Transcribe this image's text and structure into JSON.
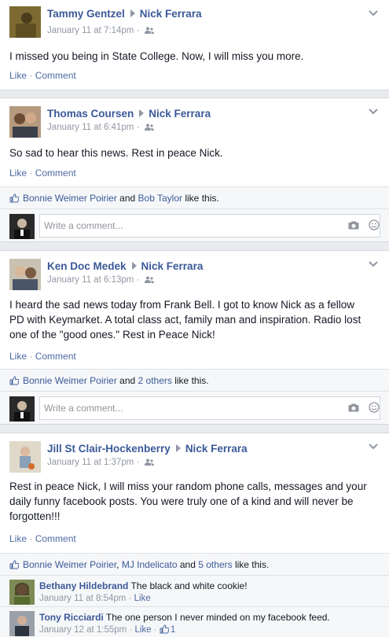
{
  "posts": [
    {
      "author": "Tammy Gentzel",
      "target": "Nick Ferrara",
      "time": "January 11 at 7:14pm",
      "meta_sep": " · ",
      "text": "I missed you being in State College. Now, I will miss you more.",
      "like_label": "Like",
      "comment_label": "Comment",
      "avatar_color": "#6b5a2e"
    },
    {
      "author": "Thomas Coursen",
      "target": "Nick Ferrara",
      "time": "January 11 at 6:41pm",
      "meta_sep": " · ",
      "text": "So sad to hear this news. Rest in peace Nick.",
      "like_label": "Like",
      "comment_label": "Comment",
      "avatar_color": "#8a6a50",
      "likes": {
        "name1": "Bonnie Weimer Poirier",
        "and": " and ",
        "name2": "Bob Taylor",
        "suffix": " like this."
      },
      "placeholder": "Write a comment..."
    },
    {
      "author": "Ken Doc Medek",
      "target": "Nick Ferrara",
      "time": "January 11 at 6:13pm",
      "meta_sep": " · ",
      "text_lines": [
        "I heard the sad news today from Frank Bell. I got to know Nick as a fellow",
        "PD with Keymarket. A total class act, family man and inspiration. Radio lost",
        "one of the \"good ones.\" Rest in Peace Nick!"
      ],
      "like_label": "Like",
      "comment_label": "Comment",
      "avatar_color": "#9a8f7a",
      "likes": {
        "name1": "Bonnie Weimer Poirier",
        "and": " and ",
        "name2": "2 others",
        "suffix": " like this."
      },
      "placeholder": "Write a comment..."
    },
    {
      "author": "Jill St Clair-Hockenberry",
      "target": "Nick Ferrara",
      "time": "January 11 at 1:37pm",
      "meta_sep": " · ",
      "text_lines": [
        "Rest in peace Nick, I will miss your random phone calls, messages and your",
        "daily funny facebook posts. You were truly one of a kind and will never be",
        "forgotten!!!"
      ],
      "like_label": "Like",
      "comment_label": "Comment",
      "avatar_color": "#c7b07a",
      "likes": {
        "name1": "Bonnie Weimer Poirier",
        "comma": ", ",
        "name2": "MJ Indelicato",
        "and": " and ",
        "name3": "5 others",
        "suffix": " like this."
      },
      "comments": [
        {
          "name": "Bethany Hildebrand",
          "text": " The black and white cookie!",
          "time": "January 11 at 8:54pm",
          "sep": " · ",
          "like": "Like",
          "avatar_color": "#5a6b3a"
        },
        {
          "name": "Tony Ricciardi",
          "text": " The one person I never minded on my facebook feed.",
          "time": "January 12 at 1:55pm",
          "sep": " · ",
          "like": "Like",
          "sep2": " · ",
          "like_count": "1",
          "avatar_color": "#4a4a52"
        }
      ]
    }
  ],
  "colors": {
    "link": "#3b5998",
    "action": "#4e69a2",
    "meta": "#9197a3",
    "background": "#e9ebee"
  }
}
